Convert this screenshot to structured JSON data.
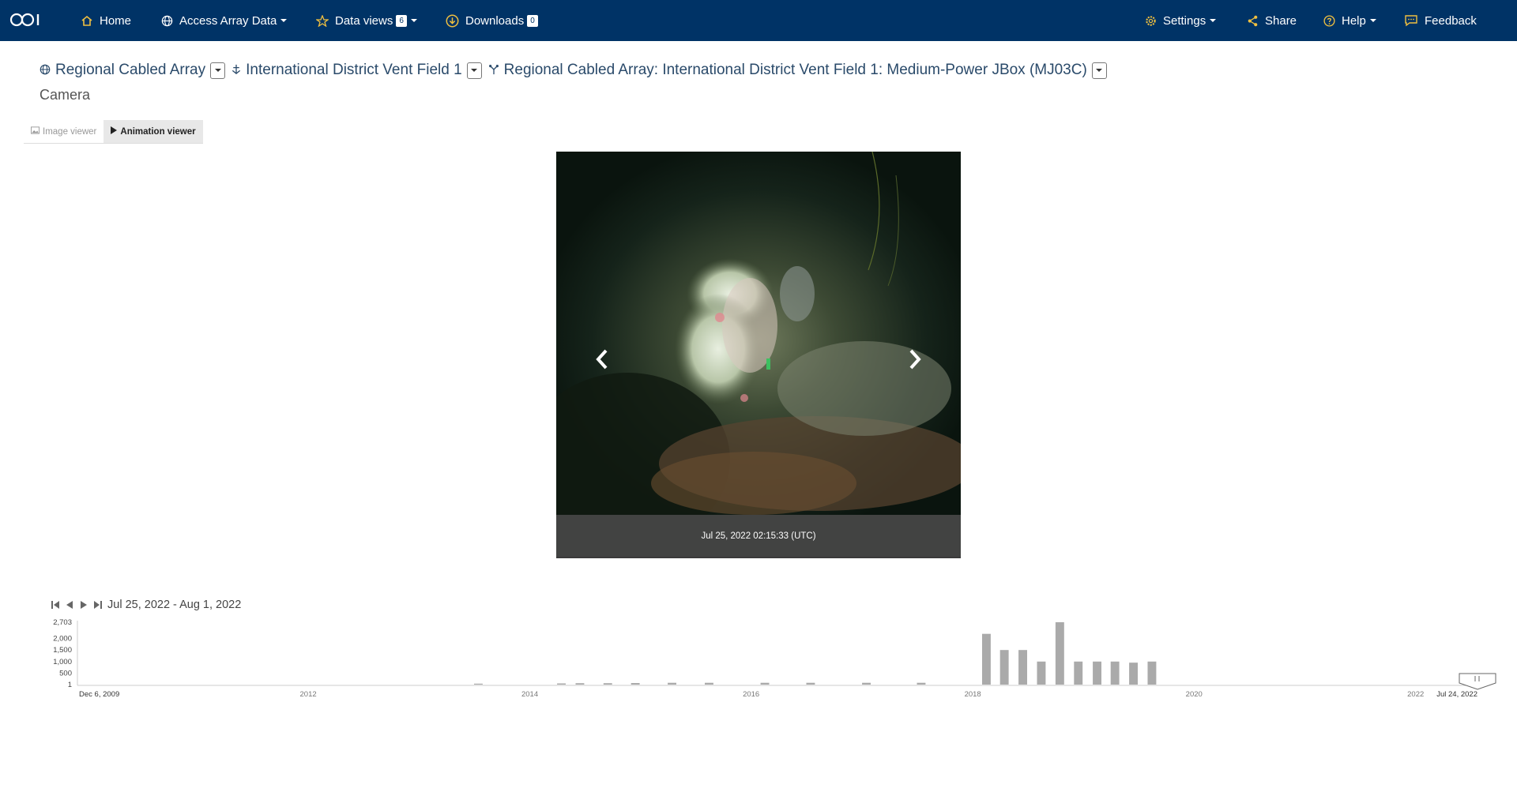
{
  "nav": {
    "home": "Home",
    "access": "Access Array Data",
    "dataviews": "Data views",
    "dataviews_count": "6",
    "downloads": "Downloads",
    "downloads_count": "0",
    "settings": "Settings",
    "share": "Share",
    "help": "Help",
    "feedback": "Feedback"
  },
  "breadcrumb": {
    "array": "Regional Cabled Array",
    "site": "International District Vent Field 1",
    "node": "Regional Cabled Array: International District Vent Field 1: Medium-Power JBox (MJ03C)"
  },
  "instrument": "Camera",
  "tabs": [
    "Image viewer",
    "Animation viewer"
  ],
  "viewer": {
    "timestamp": "Jul 25, 2022 02:15:33 (UTC)"
  },
  "timeline": {
    "range_label": "Jul 25, 2022 - Aug 1, 2022",
    "y_ticks": [
      "2,703",
      "2,000",
      "1,500",
      "1,000",
      "500",
      "1"
    ],
    "x_start": "Dec 6, 2009",
    "x_end": "Jul 24, 2022",
    "x_ticks": [
      "2012",
      "2014",
      "2016",
      "2018",
      "2020",
      "2022"
    ]
  },
  "colors": {
    "navbar": "#003366",
    "icon_accent": "#f0c040",
    "bars": "#aaaaaa"
  },
  "chart_data": {
    "type": "bar",
    "title": "",
    "xlabel": "",
    "ylabel": "",
    "ylim": [
      1,
      2703
    ],
    "x_domain": [
      "2009-12-06",
      "2022-07-24"
    ],
    "categories": [
      "2013-07",
      "2014-04",
      "2014-06",
      "2014-09",
      "2014-12",
      "2015-04",
      "2015-08",
      "2016-02",
      "2016-07",
      "2017-01",
      "2017-07",
      "2018-02",
      "2018-04",
      "2018-06",
      "2018-08",
      "2018-10",
      "2018-12",
      "2019-02",
      "2019-04",
      "2019-06",
      "2019-08"
    ],
    "values": [
      40,
      50,
      60,
      60,
      70,
      80,
      80,
      80,
      80,
      80,
      80,
      2200,
      1500,
      1500,
      1000,
      2703,
      1000,
      1000,
      1000,
      950,
      1000
    ]
  }
}
